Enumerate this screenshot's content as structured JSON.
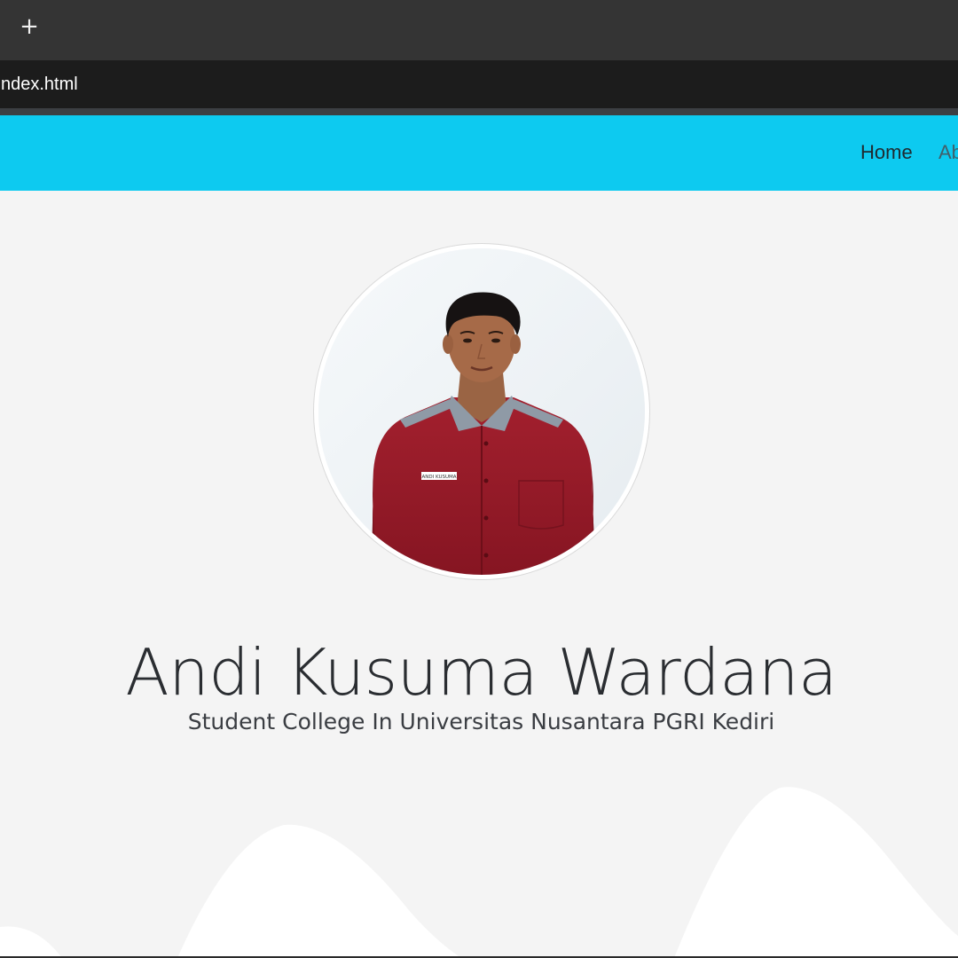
{
  "browser": {
    "new_tab_glyph": "+",
    "url_fragment": "/index.html"
  },
  "navbar": {
    "background": "#0dcaf0",
    "links": [
      {
        "label": "Home",
        "active": true
      },
      {
        "label": "Ab",
        "active": false
      }
    ]
  },
  "hero": {
    "name": "Andi Kusuma Wardana",
    "subtitle": "Student College In Universitas Nusantara PGRI Kediri",
    "background": "#f4f4f4",
    "wave_color": "#ffffff"
  },
  "profile_photo": {
    "badge_text": "ANDI KUSUMA",
    "shirt_color": "#9b1c2a",
    "collar_color": "#8f9aa6"
  }
}
